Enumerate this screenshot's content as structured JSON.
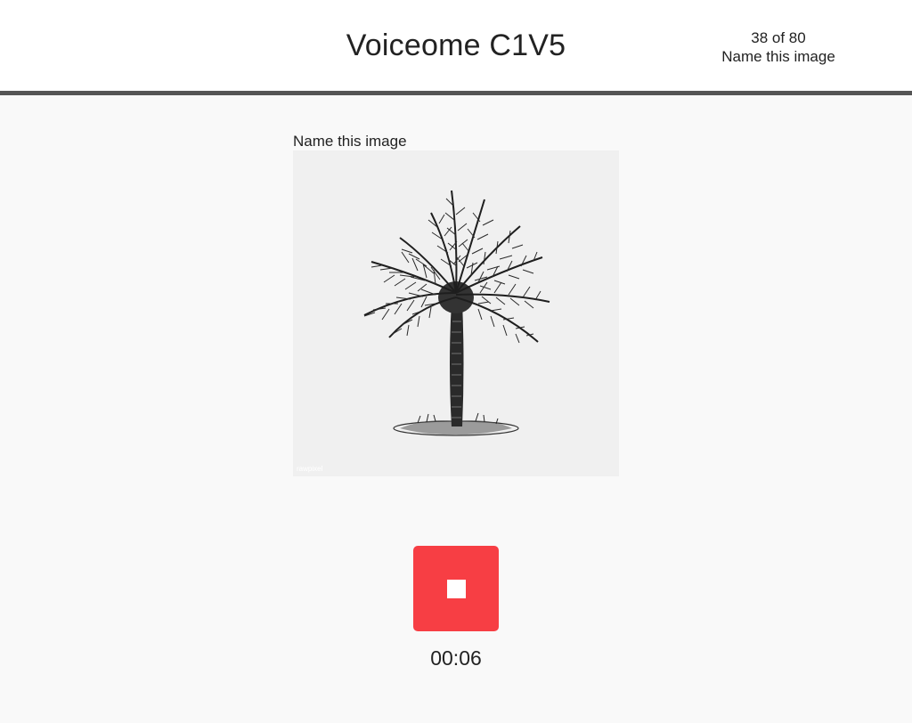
{
  "header": {
    "title": "Voiceome C1V5",
    "progress_count": "38 of 80",
    "progress_task": "Name this image"
  },
  "task": {
    "prompt": "Name this image",
    "image_subject": "palm-tree-engraving",
    "watermark": "rawpixel"
  },
  "recorder": {
    "state": "recording",
    "icon": "stop-icon",
    "timer": "00:06",
    "button_color": "#f73e44"
  },
  "colors": {
    "header_bg": "#ffffff",
    "header_border": "#555555",
    "page_bg": "#f9f9f9",
    "text": "#222222"
  }
}
